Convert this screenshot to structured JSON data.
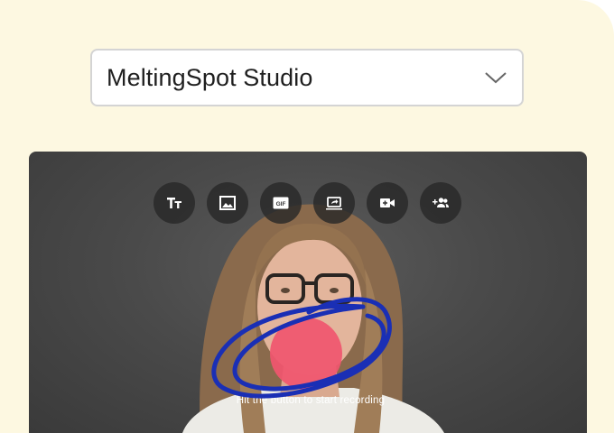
{
  "studio_select": {
    "selected": "MeltingSpot Studio",
    "icon": "chevron-down-icon"
  },
  "toolbar": {
    "tools": [
      {
        "name": "text",
        "icon": "text-size-icon"
      },
      {
        "name": "image",
        "icon": "image-icon"
      },
      {
        "name": "gif",
        "icon": "gif-icon",
        "label": "GIF"
      },
      {
        "name": "screen-share",
        "icon": "screen-share-icon"
      },
      {
        "name": "video",
        "icon": "video-add-icon"
      },
      {
        "name": "invite",
        "icon": "add-participant-icon"
      }
    ]
  },
  "recording": {
    "hint": "Hit the button to start recording",
    "button_color": "#f0566f",
    "scribble_color": "#1a2fb5"
  },
  "colors": {
    "background": "#fdf8e1",
    "stage": "#4a4a4a"
  }
}
